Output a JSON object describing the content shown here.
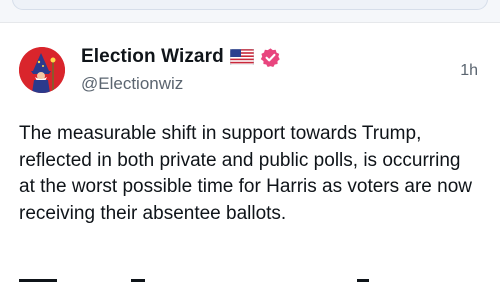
{
  "post": {
    "display_name": "Election Wizard",
    "handle": "@Electionwiz",
    "timestamp": "1h",
    "body": "The measurable shift in support towards Trump, reflected in both private and public polls, is occurring at the worst possible time for Harris as voters are now receiving their absentee ballots.",
    "avatar_icon": "wizard-avatar-icon",
    "flag_icon": "us-flag-icon",
    "verified_icon": "verified-badge-icon"
  },
  "colors": {
    "avatar_bg": "#d9252c",
    "verified_badge": "#e8457e",
    "text_primary": "#0f1419",
    "text_secondary": "#5b6570"
  }
}
